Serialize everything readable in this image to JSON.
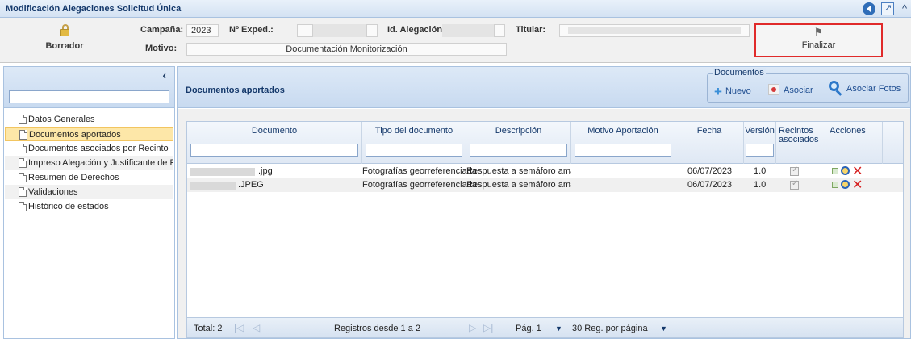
{
  "window": {
    "title": "Modificación Alegaciones Solicitud Única"
  },
  "header": {
    "status_label": "Borrador",
    "campana_label": "Campaña:",
    "campana_value": "2023",
    "expediente_label": "Nº Exped.:",
    "expediente_value": "",
    "id_alegacion_label": "Id. Alegación:",
    "id_alegacion_value": "",
    "titular_label": "Titular:",
    "titular_value": "",
    "motivo_label": "Motivo:",
    "motivo_value": "Documentación Monitorización",
    "finalizar_label": "Finalizar"
  },
  "sidebar": {
    "search_value": "",
    "items": [
      {
        "label": "Datos Generales"
      },
      {
        "label": "Documentos aportados"
      },
      {
        "label": "Documentos asociados por Recinto"
      },
      {
        "label": "Impreso Alegación y Justificante de Re"
      },
      {
        "label": "Resumen de Derechos"
      },
      {
        "label": "Validaciones"
      },
      {
        "label": "Histórico de estados"
      }
    ]
  },
  "main": {
    "section_title": "Documentos aportados",
    "toolbar": {
      "legend": "Documentos",
      "nuevo_label": "Nuevo",
      "asociar_label": "Asociar",
      "asociar_fotos_label": "Asociar Fotos"
    },
    "table": {
      "columns": [
        {
          "label": "Documento"
        },
        {
          "label": "Tipo del documento"
        },
        {
          "label": "Descripción"
        },
        {
          "label": "Motivo Aportación"
        },
        {
          "label": "Fecha"
        },
        {
          "label": "Versión"
        },
        {
          "label": "Recintos asociados"
        },
        {
          "label": "Acciones"
        }
      ],
      "rows": [
        {
          "documento": ".jpg",
          "tipo": "Fotografías georreferenciada",
          "descripcion": "Respuesta a semáforo amaril",
          "motivo": "",
          "fecha": "06/07/2023",
          "version": "1.0",
          "recintos_asociados": true
        },
        {
          "documento": ".JPEG",
          "tipo": "Fotografías georreferenciada",
          "descripcion": "Respuesta a semáforo amaril",
          "motivo": "",
          "fecha": "06/07/2023",
          "version": "1.0",
          "recintos_asociados": true
        }
      ]
    },
    "pager": {
      "total": "Total: 2",
      "registros": "Registros desde 1 a 2",
      "pagina": "Pág. 1",
      "por_pagina": "30 Reg. por página"
    }
  },
  "colors": {
    "header_blue": "#d4e2f3",
    "selected_item": "#fde7a8",
    "finalizar_border": "#e02a2a",
    "delete_red": "#d62020"
  }
}
